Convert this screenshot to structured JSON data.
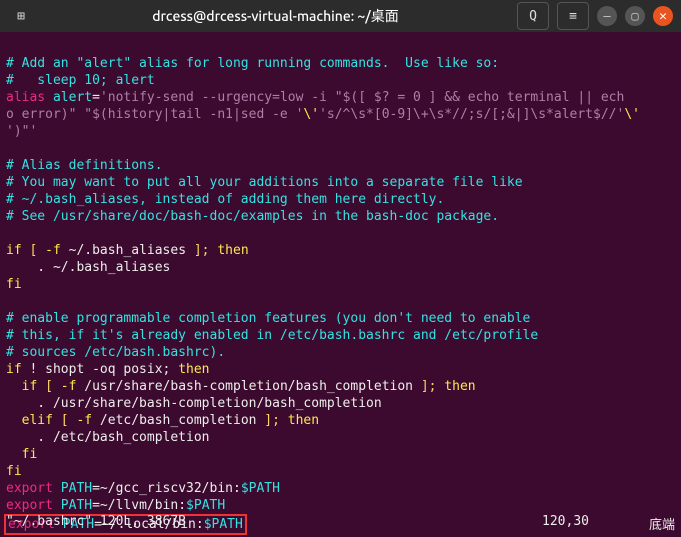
{
  "titlebar": {
    "title": "drcess@drcess-virtual-machine: ~/桌面",
    "icons": {
      "new_tab": "⊞",
      "search": "Q",
      "menu": "≡",
      "min": "—",
      "max": "▢",
      "close": "✕"
    }
  },
  "lines": {
    "l1": "# Add an \"alert\" alias for long running commands.  Use like so:",
    "l2": "#   sleep 10; alert",
    "l3a": "alias",
    "l3b": " alert",
    "l3c": "=",
    "l3d": "'notify-send --urgency=low -i \"$([ $? = 0 ] && echo terminal || ech",
    "l4a": "o error)\" \"$(history|tail -n1|sed -e '",
    "l4b": "\\'",
    "l4c": "'s/^\\s*[0-9]\\+\\s*//;s/[;&|]\\s*alert$//'",
    "l4d": "\\'",
    "l5": "')\"'",
    "l6": "",
    "l7": "# Alias definitions.",
    "l8": "# You may want to put all your additions into a separate file like",
    "l9": "# ~/.bash_aliases, instead of adding them here directly.",
    "l10": "# See /usr/share/doc/bash-doc/examples in the bash-doc package.",
    "l11": "",
    "l12a": "if",
    "l12b": " [ ",
    "l12c": "-f",
    "l12d": " ~/.bash_aliases ",
    "l12e": "]; ",
    "l12f": "then",
    "l13": "    . ~/.bash_aliases",
    "l14": "fi",
    "l15": "",
    "l16": "# enable programmable completion features (you don't need to enable",
    "l17": "# this, if it's already enabled in /etc/bash.bashrc and /etc/profile",
    "l18": "# sources /etc/bash.bashrc).",
    "l19a": "if",
    "l19b": " ! shopt -oq posix",
    "l19c": "; ",
    "l19d": "then",
    "l20a": "  if",
    "l20b": " [ ",
    "l20c": "-f",
    "l20d": " /usr/share/bash-completion/bash_completion ",
    "l20e": "]; ",
    "l20f": "then",
    "l21": "    . /usr/share/bash-completion/bash_completion",
    "l22a": "  elif",
    "l22b": " [ ",
    "l22c": "-f",
    "l22d": " /etc/bash_completion ",
    "l22e": "]; ",
    "l22f": "then",
    "l23": "    . /etc/bash_completion",
    "l24": "  fi",
    "l25": "fi",
    "l26a": "export",
    "l26b": " PATH",
    "l26c": "=~",
    "l26d": "/gcc_riscv32/bin:",
    "l26e": "$PATH",
    "l27a": "export",
    "l27b": " PATH",
    "l27c": "=~",
    "l27d": "/llvm/bin:",
    "l27e": "$PATH",
    "l28a": "export",
    "l28b": " PATH",
    "l28c": "=~",
    "l28d": "/.local/bin:",
    "l28e": "$PATH"
  },
  "status": {
    "file": "\"~/.bashrc\" 120L, 3867B",
    "pos": "120,30",
    "mode": "底端"
  }
}
